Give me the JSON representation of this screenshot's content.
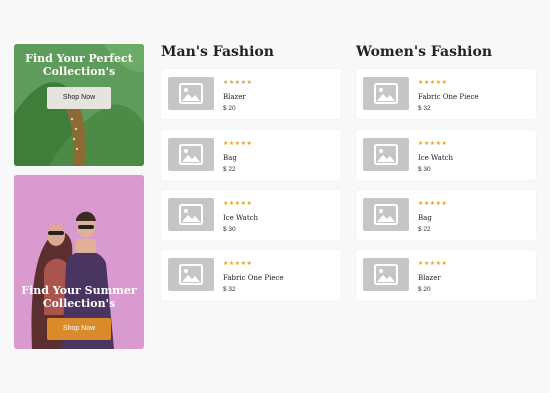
{
  "promos": [
    {
      "title": "Find Your Perfect Collection's",
      "button": "Shop Now"
    },
    {
      "title": "Find Your Summer Collection's",
      "button": "Shop Now"
    }
  ],
  "sections": [
    {
      "title": "Man's Fashion",
      "products": [
        {
          "name": "Blazer",
          "price": "$ 20",
          "rating": 5,
          "stars": "★★★★★"
        },
        {
          "name": "Bag",
          "price": "$ 22",
          "rating": 5,
          "stars": "★★★★★"
        },
        {
          "name": "Ice Watch",
          "price": "$ 30",
          "rating": 5,
          "stars": "★★★★★"
        },
        {
          "name": "Fabric One Piece",
          "price": "$ 32",
          "rating": 5,
          "stars": "★★★★★"
        }
      ]
    },
    {
      "title": "Women's Fashion",
      "products": [
        {
          "name": "Fabric One Piece",
          "price": "$ 32",
          "rating": 5,
          "stars": "★★★★★"
        },
        {
          "name": "Ice Watch",
          "price": "$ 30",
          "rating": 5,
          "stars": "★★★★★"
        },
        {
          "name": "Bag",
          "price": "$ 22",
          "rating": 5,
          "stars": "★★★★★"
        },
        {
          "name": "Blazer",
          "price": "$ 20",
          "rating": 5,
          "stars": "★★★★★"
        }
      ]
    }
  ],
  "colors": {
    "promo1_bg": "#5a9a58",
    "promo2_bg": "#d99ad0",
    "accent_orange": "#d98a2a",
    "star": "#e0a128",
    "thumb_placeholder": "#c6c6c6"
  },
  "icons": {
    "thumbnail": "image-placeholder-icon",
    "rating": "star-icon"
  }
}
